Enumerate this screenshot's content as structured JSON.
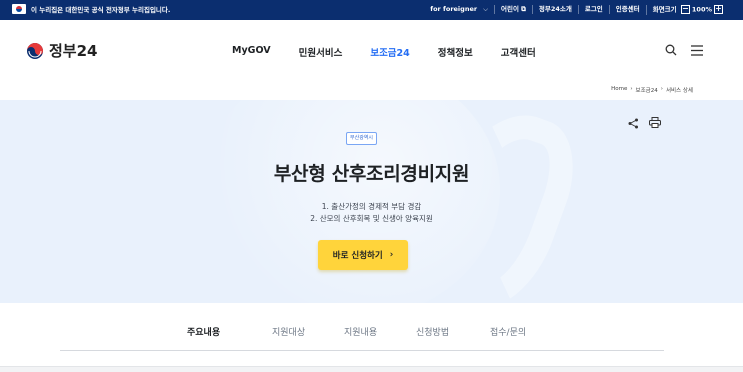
{
  "topbar": {
    "gov_notice": "이 누리집은 대한민국 공식 전자정부 누리집입니다.",
    "links": [
      "for foreigner",
      "어린이",
      "정부24소개",
      "로그인",
      "인증센터",
      "화면크기"
    ],
    "zoom": "100%"
  },
  "header": {
    "logo_text": "정부24",
    "nav": [
      "MyGOV",
      "민원서비스",
      "보조금24",
      "정책정보",
      "고객센터"
    ],
    "active_nav": "보조금24"
  },
  "breadcrumb": [
    "Home",
    "보조금24",
    "서비스 상세"
  ],
  "hero": {
    "badge": "부산광역시",
    "title": "부산형 산후조리경비지원",
    "desc_lines": [
      "1. 출산가정의 경제적 부담 경감",
      "2. 산모의 산후회복 및 신생아 양육지원"
    ],
    "apply_label": "바로 신청하기"
  },
  "tabs": [
    "주요내용",
    "지원대상",
    "지원내용",
    "신청방법",
    "접수/문의"
  ],
  "colors": {
    "topbar": "#0b2e6f",
    "accent": "#256ef4",
    "hero_bg": "#e9f1fc",
    "apply_button": "#ffd43b"
  }
}
